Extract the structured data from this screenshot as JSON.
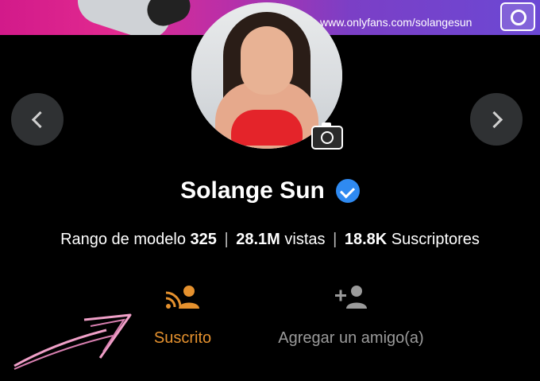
{
  "banner": {
    "url": "www.onlyfans.com/solangesun",
    "camera_icon": "camera-icon"
  },
  "profile": {
    "avatar_icon": "camera-icon",
    "name": "Solange Sun",
    "verified_icon": "verified-check-icon"
  },
  "nav": {
    "prev_icon": "chevron-left-icon",
    "next_icon": "chevron-right-icon"
  },
  "stats": {
    "rank_label": "Rango de modelo",
    "rank_value": "325",
    "views_value": "28.1M",
    "views_label": "vistas",
    "subs_value": "18.8K",
    "subs_label": "Suscriptores"
  },
  "actions": {
    "subscribed_label": "Suscrito",
    "subscribed_icon": "rss-user-icon",
    "add_friend_label": "Agregar un amigo(a)",
    "add_friend_icon": "add-user-icon"
  },
  "colors": {
    "accent_orange": "#e5912e",
    "verified_blue": "#2f8af1",
    "muted_gray": "#9a9a9a",
    "annotation_arrow": "#f0a0c8"
  }
}
